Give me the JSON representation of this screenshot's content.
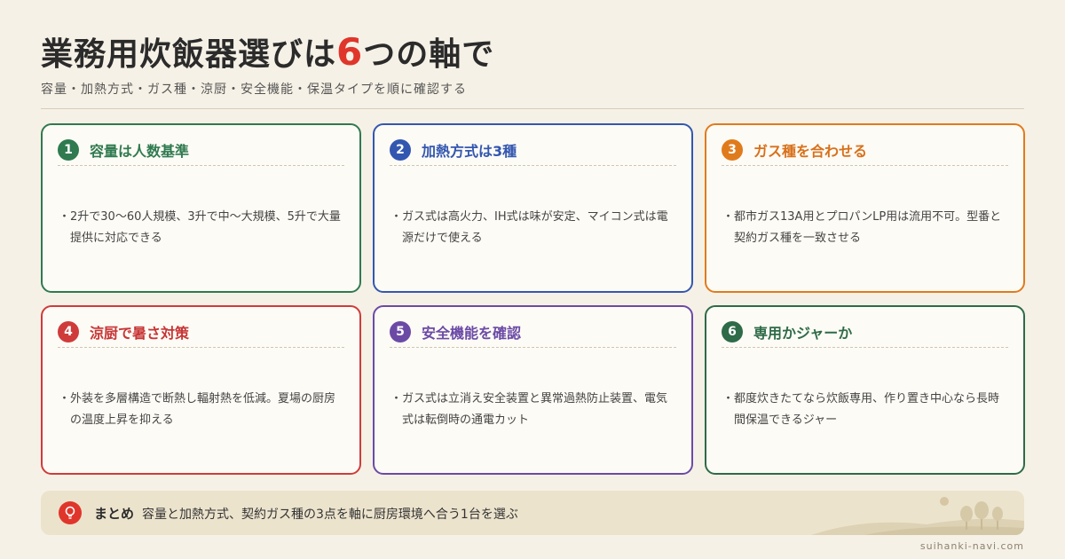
{
  "header": {
    "title_before": "業務用炊飯器選びは",
    "title_number": "6",
    "title_after": "つの軸で",
    "subtitle": "容量・加熱方式・ガス種・涼厨・安全機能・保温タイプを順に確認する"
  },
  "cards": [
    {
      "num": "1",
      "title": "容量は人数基準",
      "bullet": "・",
      "body": "2升で30〜60人規模、3升で中〜大規模、5升で大量提供に対応できる",
      "color": "#2f7a4f"
    },
    {
      "num": "2",
      "title": "加熱方式は3種",
      "bullet": "・",
      "body": "ガス式は高火力、IH式は味が安定、マイコン式は電源だけで使える",
      "color": "#3357b0"
    },
    {
      "num": "3",
      "title": "ガス種を合わせる",
      "bullet": "・",
      "body": "都市ガス13A用とプロパンLP用は流用不可。型番と契約ガス種を一致させる",
      "color": "#e07b1d"
    },
    {
      "num": "4",
      "title": "涼厨で暑さ対策",
      "bullet": "・",
      "body": "外装を多層構造で断熱し輻射熱を低減。夏場の厨房の温度上昇を抑える",
      "color": "#cf3b3b"
    },
    {
      "num": "5",
      "title": "安全機能を確認",
      "bullet": "・",
      "body": "ガス式は立消え安全装置と異常過熱防止装置、電気式は転倒時の通電カット",
      "color": "#6b4aa6"
    },
    {
      "num": "6",
      "title": "専用かジャーか",
      "bullet": "・",
      "body": "都度炊きたてなら炊飯専用、作り置き中心なら長時間保温できるジャー",
      "color": "#2e6b48"
    }
  ],
  "summary": {
    "icon": "lightbulb-icon",
    "label": "まとめ",
    "text": "容量と加熱方式、契約ガス種の3点を軸に厨房環境へ合う1台を選ぶ"
  },
  "footer": {
    "site": "suihanki-navi.com"
  },
  "colors": {
    "accent": "#e0352b",
    "background": "#f6f1e6"
  }
}
